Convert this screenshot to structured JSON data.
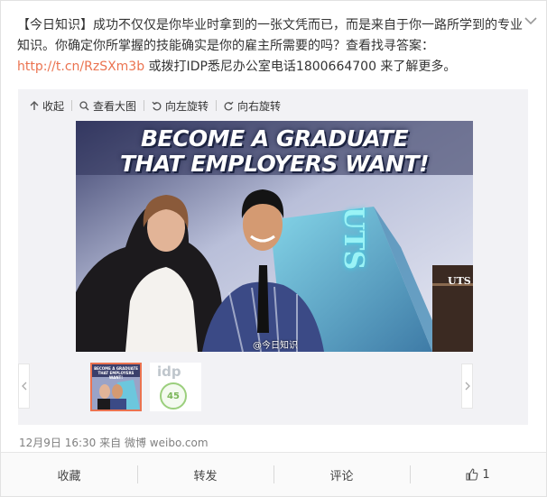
{
  "post": {
    "text_prefix": "【今日知识】成功不仅仅是你毕业时拿到的一张文凭而已，而是来自于你一路所学到的专业知识。你确定你所掌握的技能确实是你的雇主所需要的吗？查看找寻答案：",
    "link_text": "http://t.cn/RzSXm3b",
    "text_suffix": " 或拨打IDP悉尼办公室电话1800664700 来了解更多。"
  },
  "toolbar": {
    "collapse": "收起",
    "view_large": "查看大图",
    "rotate_left": "向左旋转",
    "rotate_right": "向右旋转"
  },
  "photo": {
    "headline_line1": "BECOME A GRADUATE",
    "headline_line2": "THAT EMPLOYERS WANT!",
    "building_sign": "UTS",
    "building_sign_small": "UTS",
    "watermark": "@今日知识"
  },
  "thumbs": {
    "thumb1_line1": "BECOME A GRADUATE",
    "thumb1_line2": "THAT EMPLOYERS WANT!",
    "thumb2_logo": "idp",
    "thumb2_badge": "45"
  },
  "meta": {
    "date": "12月9日 16:30",
    "source_prefix": "来自",
    "source": "微博 weibo.com"
  },
  "actions": {
    "favorite": "收藏",
    "repost": "转发",
    "comment": "评论",
    "like_count": "1"
  },
  "colors": {
    "link": "#eb7350",
    "accent_border": "#eb7350"
  }
}
